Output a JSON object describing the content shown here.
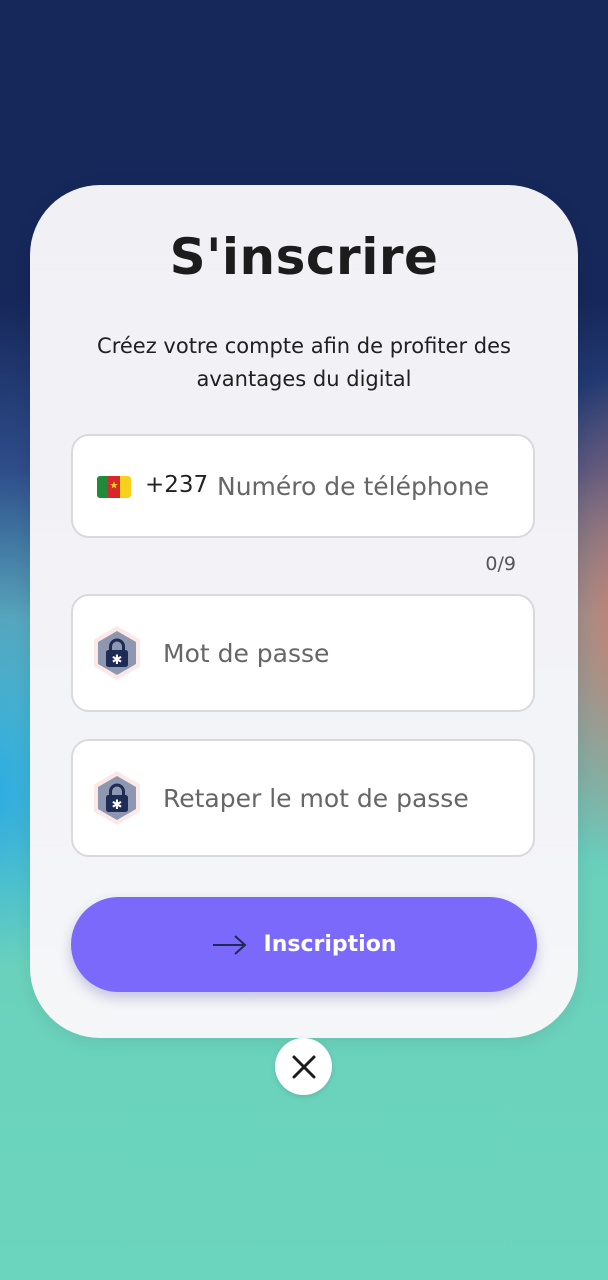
{
  "screen": {
    "title": "S'inscrire",
    "subtitle": "Créez votre compte afin de profiter des avantages du digital"
  },
  "phone": {
    "flag_icon": "cameroon-flag-icon",
    "dial_code": "+237",
    "placeholder": "Numéro de téléphone",
    "value": "",
    "counter": "0/9"
  },
  "password": {
    "icon": "lock-icon",
    "placeholder": "Mot de passe",
    "value": ""
  },
  "password_confirm": {
    "icon": "lock-icon",
    "placeholder": "Retaper le mot de passe",
    "value": ""
  },
  "submit": {
    "icon": "arrow-right-icon",
    "label": "Inscription"
  },
  "close": {
    "icon": "close-icon"
  },
  "colors": {
    "accent": "#7a69fb",
    "lock_badge": "#8e97b0",
    "lock": "#1d2b55"
  }
}
